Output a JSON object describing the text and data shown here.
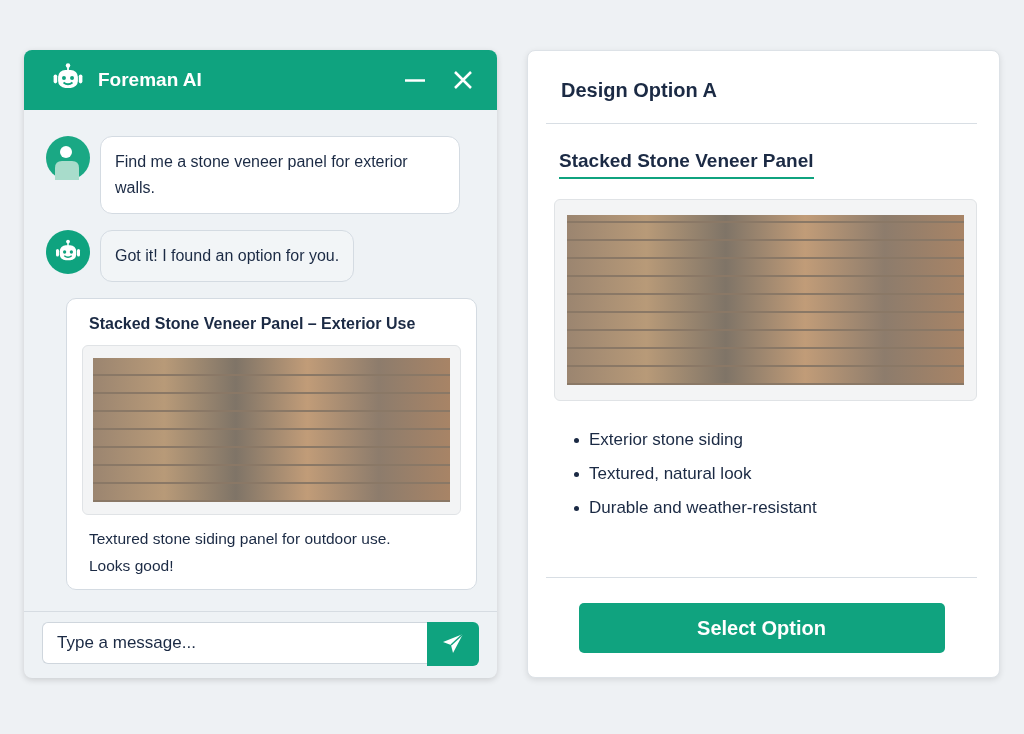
{
  "chat_window": {
    "title": "Foreman AI",
    "messages": [
      {
        "kind": "user",
        "text": "Find me a stone veneer panel for exterior walls."
      },
      {
        "kind": "bot",
        "text": "Got it! I found an option for you."
      },
      {
        "kind": "product",
        "title": "Stacked Stone Veneer Panel – Exterior Use",
        "text": "Textured stone siding panel for outdoor use. Looks good!"
      }
    ],
    "input": {
      "placeholder": "Type a message..."
    }
  },
  "design_option": {
    "title": "Design Option A",
    "product_name": "Stacked Stone Veneer Panel",
    "features": [
      "Exterior stone siding",
      "Textured, natural look",
      "Durable and weather-resistant"
    ],
    "button": "Select Option"
  }
}
